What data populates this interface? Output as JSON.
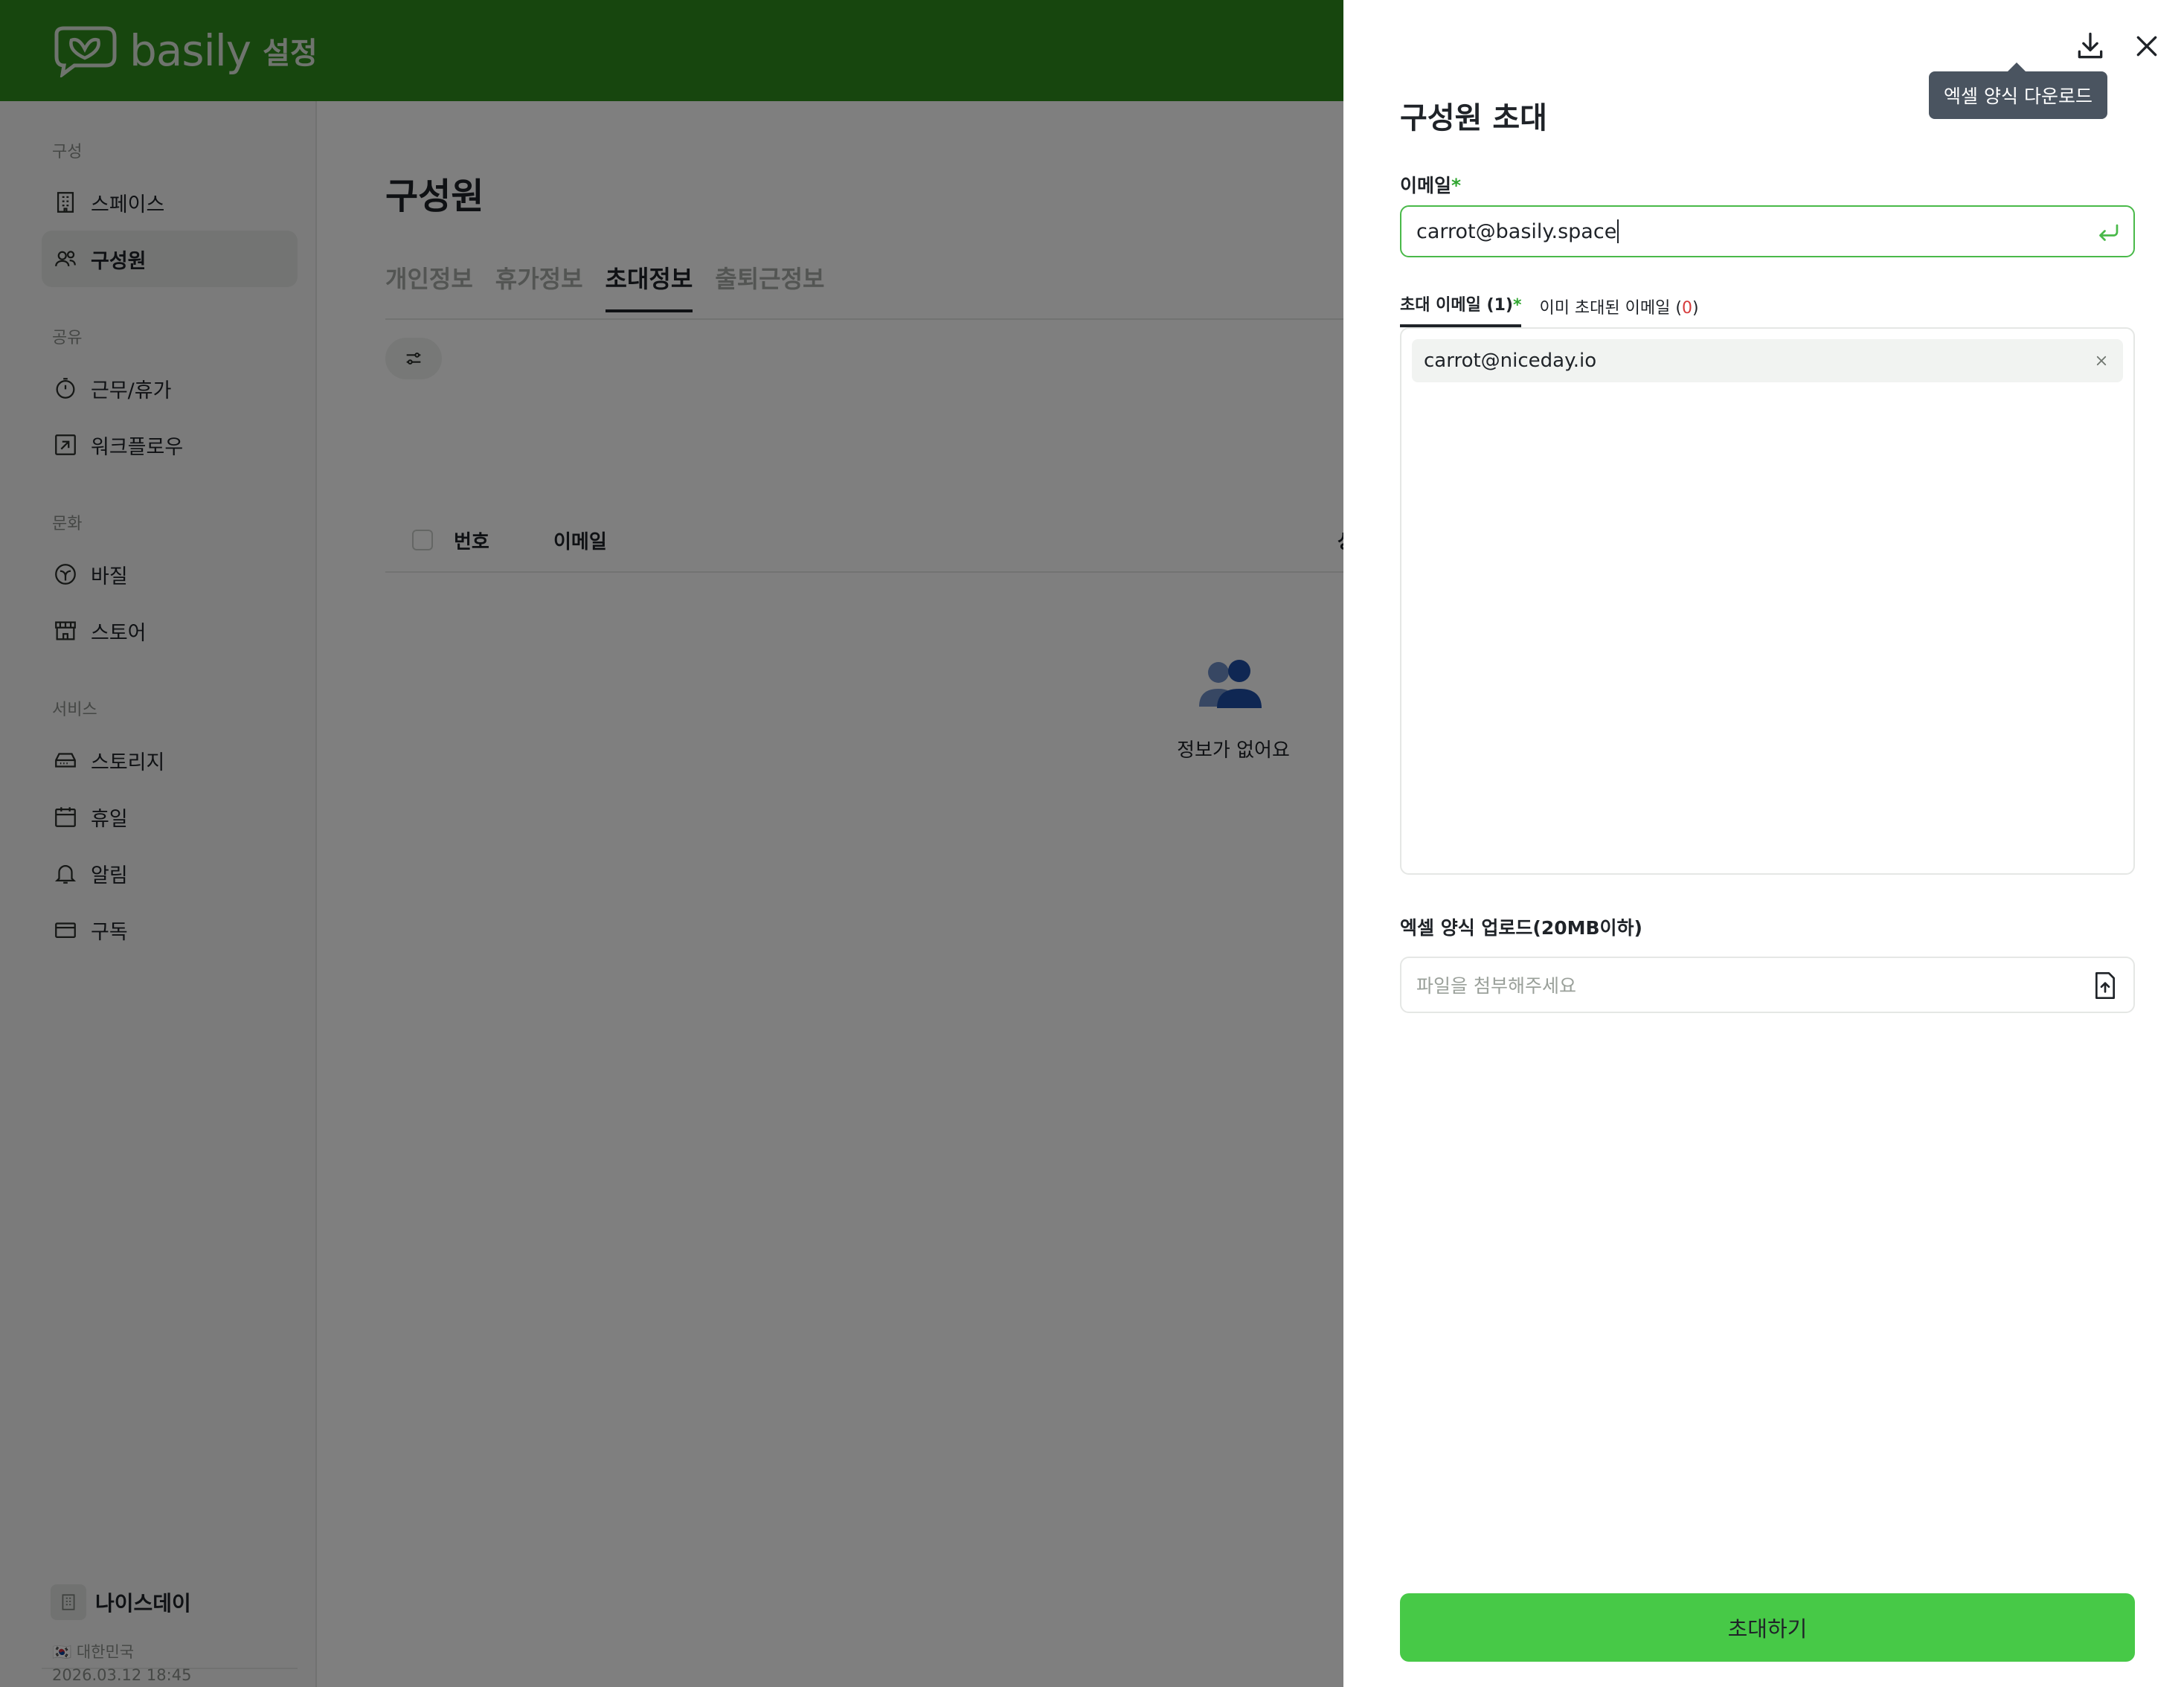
{
  "app": {
    "brand": "basily",
    "section": "설정"
  },
  "sidebar": {
    "sections": [
      {
        "title": "구성",
        "items": [
          {
            "label": "스페이스",
            "icon": "building-icon"
          },
          {
            "label": "구성원",
            "icon": "users-icon",
            "active": true
          }
        ]
      },
      {
        "title": "공유",
        "items": [
          {
            "label": "근무/휴가",
            "icon": "stopwatch-icon"
          },
          {
            "label": "워크플로우",
            "icon": "workflow-icon"
          }
        ]
      },
      {
        "title": "문화",
        "items": [
          {
            "label": "바질",
            "icon": "basil-leaf-icon"
          },
          {
            "label": "스토어",
            "icon": "store-icon"
          }
        ]
      },
      {
        "title": "서비스",
        "items": [
          {
            "label": "스토리지",
            "icon": "storage-icon"
          },
          {
            "label": "휴일",
            "icon": "calendar-icon"
          },
          {
            "label": "알림",
            "icon": "bell-icon"
          },
          {
            "label": "구독",
            "icon": "credit-card-icon"
          }
        ]
      }
    ],
    "org": {
      "name": "나이스데이",
      "country": "🇰🇷 대한민국",
      "datetime": "2026.03.12 18:45"
    }
  },
  "main": {
    "title": "구성원",
    "tabs": [
      {
        "label": "개인정보"
      },
      {
        "label": "휴가정보"
      },
      {
        "label": "초대정보",
        "active": true
      },
      {
        "label": "출퇴근정보"
      }
    ],
    "table": {
      "headers": [
        "번호",
        "이메일",
        "상"
      ]
    },
    "empty_text": "정보가 없어요"
  },
  "drawer": {
    "tooltip": "엑셀 양식 다운로드",
    "title": "구성원 초대",
    "email_label": "이메일",
    "required_mark": "*",
    "email_value": "carrot@basily.space",
    "subtabs": {
      "invite_label": "초대 이메일 (1)",
      "already_label": "이미 초대된 이메일 (",
      "already_count": "0",
      "already_close": ")"
    },
    "invite_list": [
      "carrot@niceday.io"
    ],
    "upload_label": "엑셀 양식 업로드(20MB이하)",
    "upload_placeholder": "파일을 첨부해주세요",
    "submit_label": "초대하기"
  },
  "colors": {
    "brand_green": "#2f8c1d",
    "accent_green": "#47c947",
    "required_green": "#2fa52f",
    "count_red": "#d63b3b",
    "tooltip_bg": "#4a5460"
  }
}
